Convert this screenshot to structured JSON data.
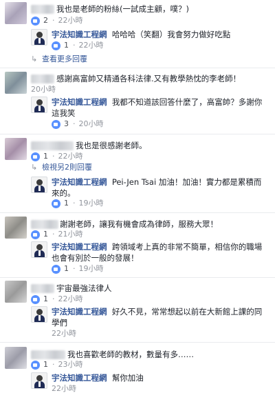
{
  "page_name": "宇法知識工程網",
  "threads": [
    {
      "comment": {
        "text": "我也是老師的粉絲(一試成主顧，噗？)",
        "likes": "2",
        "time": "22小時"
      },
      "reply": {
        "text": "哈哈哈（笑翻）我會努力做好吃點",
        "likes": "1",
        "time": "22小時"
      },
      "more_replies": "查看更多回覆"
    },
    {
      "comment": {
        "text": "感謝高富帥又精通各科法律.又有教學熱忱的李老師！",
        "time": "20小時"
      },
      "reply": {
        "text_line1": "我都不知道該回答什麼了，高富帥？多謝你",
        "text_line2": "這我笑",
        "likes": "3",
        "time": "20小時"
      }
    },
    {
      "comment": {
        "text": "我也是很感謝老師。",
        "likes": "1",
        "time": "22小時"
      },
      "more_replies": "檢視另2則回覆",
      "reply": {
        "text_line1": "Pei-Jen Tsai 加油！加油！實力都是累積而",
        "text_line2": "來的。",
        "likes": "1",
        "time": "19小時"
      }
    },
    {
      "comment": {
        "text": "謝謝老師，讓我有機會成為律師，服務大眾！",
        "likes": "1",
        "time": "21小時"
      },
      "reply": {
        "text_line1": "跨領域考上真的非常不簡單，相信你的職場",
        "text_line2": "也會有別於一般的發展！",
        "likes": "1",
        "time": "19小時"
      }
    },
    {
      "comment": {
        "text": "宇宙最強法律人",
        "likes": "1",
        "time": "22小時"
      },
      "reply": {
        "text_line1": "好久不見，常常想起以前在大新館上課的同",
        "text_line2": "學們",
        "time": "22小時"
      }
    },
    {
      "comment": {
        "text": "我也喜歡老師的教材，數量有多……",
        "likes": "1",
        "time": "23小時"
      },
      "reply": {
        "text": "幫你加油",
        "time": "22小時"
      }
    }
  ]
}
